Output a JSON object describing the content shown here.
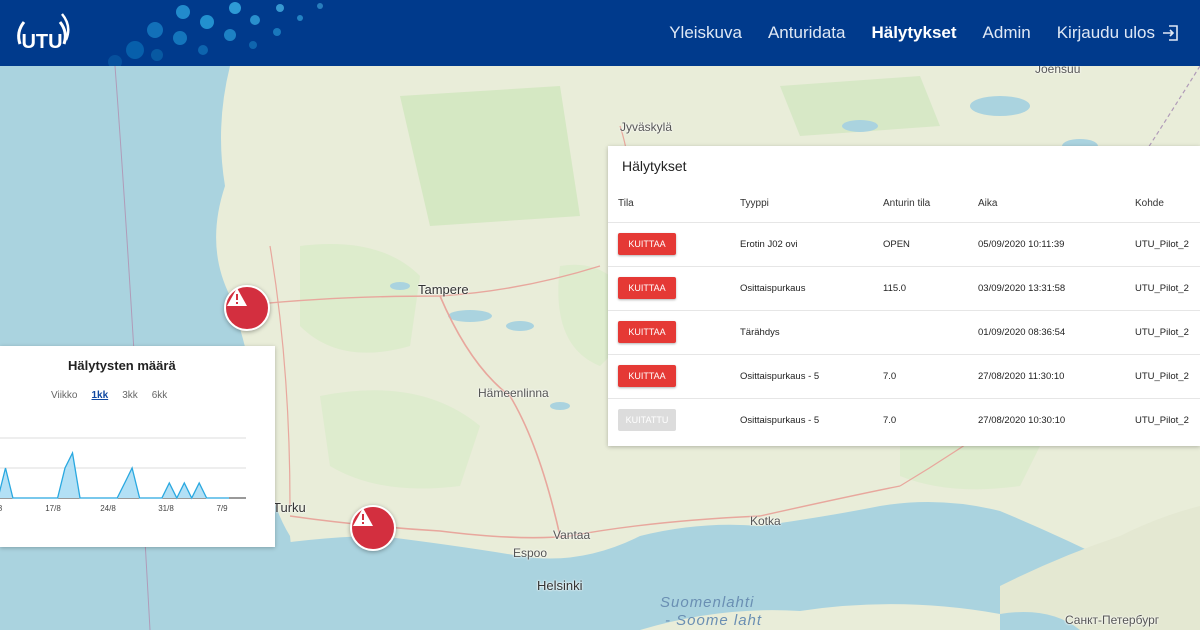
{
  "header": {
    "logo_text": "UTU",
    "nav": [
      {
        "label": "Yleiskuva",
        "active": false
      },
      {
        "label": "Anturidata",
        "active": false
      },
      {
        "label": "Hälytykset",
        "active": true
      },
      {
        "label": "Admin",
        "active": false
      },
      {
        "label": "Kirjaudu ulos",
        "active": false
      }
    ]
  },
  "map": {
    "cities": [
      "Jyväskylä",
      "Tampere",
      "Hämeenlinna",
      "Turku",
      "Vantaa",
      "Espoo",
      "Helsinki",
      "Kotka",
      "Joensuu",
      "Санкт-Петербург"
    ],
    "sea": [
      "Suomenlahti",
      "- Soome laht"
    ],
    "markers": [
      "warning-marker",
      "warning-marker"
    ]
  },
  "alerts": {
    "title": "Hälytykset",
    "columns": [
      "Tila",
      "Tyyppi",
      "Anturin tila",
      "Aika",
      "Kohde"
    ],
    "rows": [
      {
        "status": "KUITTAA",
        "acknowledged": false,
        "type": "Erotin J02 ovi",
        "sensor_state": "OPEN",
        "time": "05/09/2020 10:11:39",
        "target": "UTU_Pilot_2"
      },
      {
        "status": "KUITTAA",
        "acknowledged": false,
        "type": "Osittaispurkaus",
        "sensor_state": "115.0",
        "time": "03/09/2020 13:31:58",
        "target": "UTU_Pilot_2"
      },
      {
        "status": "KUITTAA",
        "acknowledged": false,
        "type": "Tärähdys",
        "sensor_state": "",
        "time": "01/09/2020 08:36:54",
        "target": "UTU_Pilot_2"
      },
      {
        "status": "KUITTAA",
        "acknowledged": false,
        "type": "Osittaispurkaus - 5",
        "sensor_state": "7.0",
        "time": "27/08/2020 11:30:10",
        "target": "UTU_Pilot_2"
      },
      {
        "status": "KUITATTU",
        "acknowledged": true,
        "type": "Osittaispurkaus - 5",
        "sensor_state": "7.0",
        "time": "27/08/2020 10:30:10",
        "target": "UTU_Pilot_2"
      }
    ]
  },
  "alert_chart": {
    "title": "Hälytysten määrä",
    "ranges": [
      {
        "label": "Viikko",
        "active": false
      },
      {
        "label": "1kk",
        "active": true
      },
      {
        "label": "3kk",
        "active": false
      },
      {
        "label": "6kk",
        "active": false
      }
    ]
  },
  "chart_data": {
    "type": "area",
    "title": "Hälytysten määrä",
    "x_tick_labels": [
      "8",
      "17/8",
      "24/8",
      "31/8",
      "7/9"
    ],
    "x": [
      "9/8",
      "10/8",
      "11/8",
      "12/8",
      "13/8",
      "14/8",
      "15/8",
      "16/8",
      "17/8",
      "18/8",
      "19/8",
      "20/8",
      "21/8",
      "22/8",
      "23/8",
      "24/8",
      "25/8",
      "26/8",
      "27/8",
      "28/8",
      "29/8",
      "30/8",
      "31/8",
      "1/9",
      "2/9",
      "3/9",
      "4/9",
      "5/9",
      "6/9",
      "7/9",
      "8/9",
      "9/9"
    ],
    "values": [
      0,
      2,
      0,
      0,
      0,
      0,
      0,
      0,
      0,
      2,
      3,
      0,
      0,
      0,
      0,
      0,
      0,
      1,
      2,
      0,
      0,
      0,
      0,
      1,
      0,
      1,
      0,
      1,
      0,
      0,
      0,
      0
    ],
    "grid": true,
    "color": "#29a8e0",
    "fill": "#b3e0f5"
  }
}
